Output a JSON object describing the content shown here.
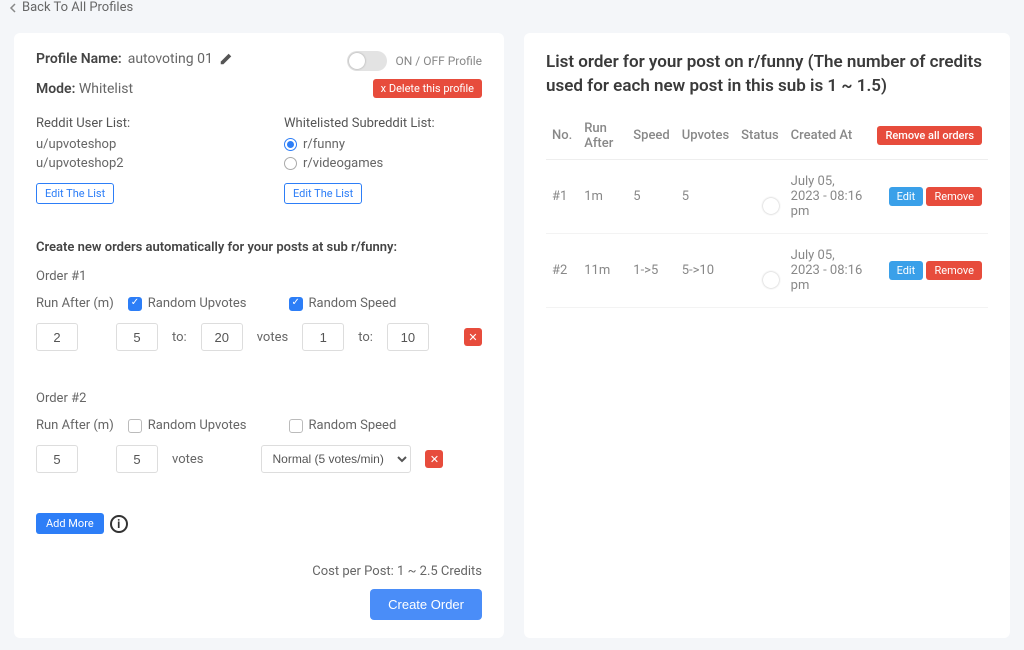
{
  "back_link": "Back To All Profiles",
  "profile_name_label": "Profile Name:",
  "profile_name_value": "autovoting 01",
  "onoff_label": "ON / OFF Profile",
  "delete_profile": "x Delete this profile",
  "mode_label": "Mode:",
  "mode_value": "Whitelist",
  "reddit_user_list_title": "Reddit User List:",
  "reddit_users": [
    "u/upvoteshop",
    "u/upvoteshop2"
  ],
  "whitelist_title": "Whitelisted Subreddit List:",
  "subreddits": [
    {
      "name": "r/funny",
      "selected": true
    },
    {
      "name": "r/videogames",
      "selected": false
    }
  ],
  "edit_list": "Edit The List",
  "create_section_title": "Create new orders automatically for your posts at sub r/funny:",
  "order1": {
    "label": "Order #1",
    "run_after_label": "Run After (m)",
    "random_upvotes_label": "Random Upvotes",
    "random_speed_label": "Random Speed",
    "run_after": "2",
    "upvotes_from": "5",
    "upvotes_to": "20",
    "votes_label": "votes",
    "to_label": "to:",
    "speed_from": "1",
    "speed_to": "10"
  },
  "order2": {
    "label": "Order #2",
    "run_after_label": "Run After (m)",
    "random_upvotes_label": "Random Upvotes",
    "random_speed_label": "Random Speed",
    "run_after": "5",
    "votes_value": "5",
    "votes_label": "votes",
    "speed_option": "Normal (5 votes/min)"
  },
  "add_more": "Add More",
  "cost_label": "Cost per Post: 1 ~ 2.5 Credits",
  "create_order_btn": "Create Order",
  "right_title": "List order for your post on r/funny (The number of credits used for each new post in this sub is 1 ~ 1.5)",
  "columns": {
    "no": "No.",
    "run_after": "Run After",
    "speed": "Speed",
    "upvotes": "Upvotes",
    "status": "Status",
    "created": "Created At"
  },
  "remove_all": "Remove all orders",
  "rows": [
    {
      "no": "#1",
      "run_after": "1m",
      "speed": "5",
      "upvotes": "5",
      "created": "July 05, 2023 - 08:16 pm"
    },
    {
      "no": "#2",
      "run_after": "11m",
      "speed": "1->5",
      "upvotes": "5->10",
      "created": "July 05, 2023 - 08:16 pm"
    }
  ],
  "btn_edit": "Edit",
  "btn_remove": "Remove"
}
